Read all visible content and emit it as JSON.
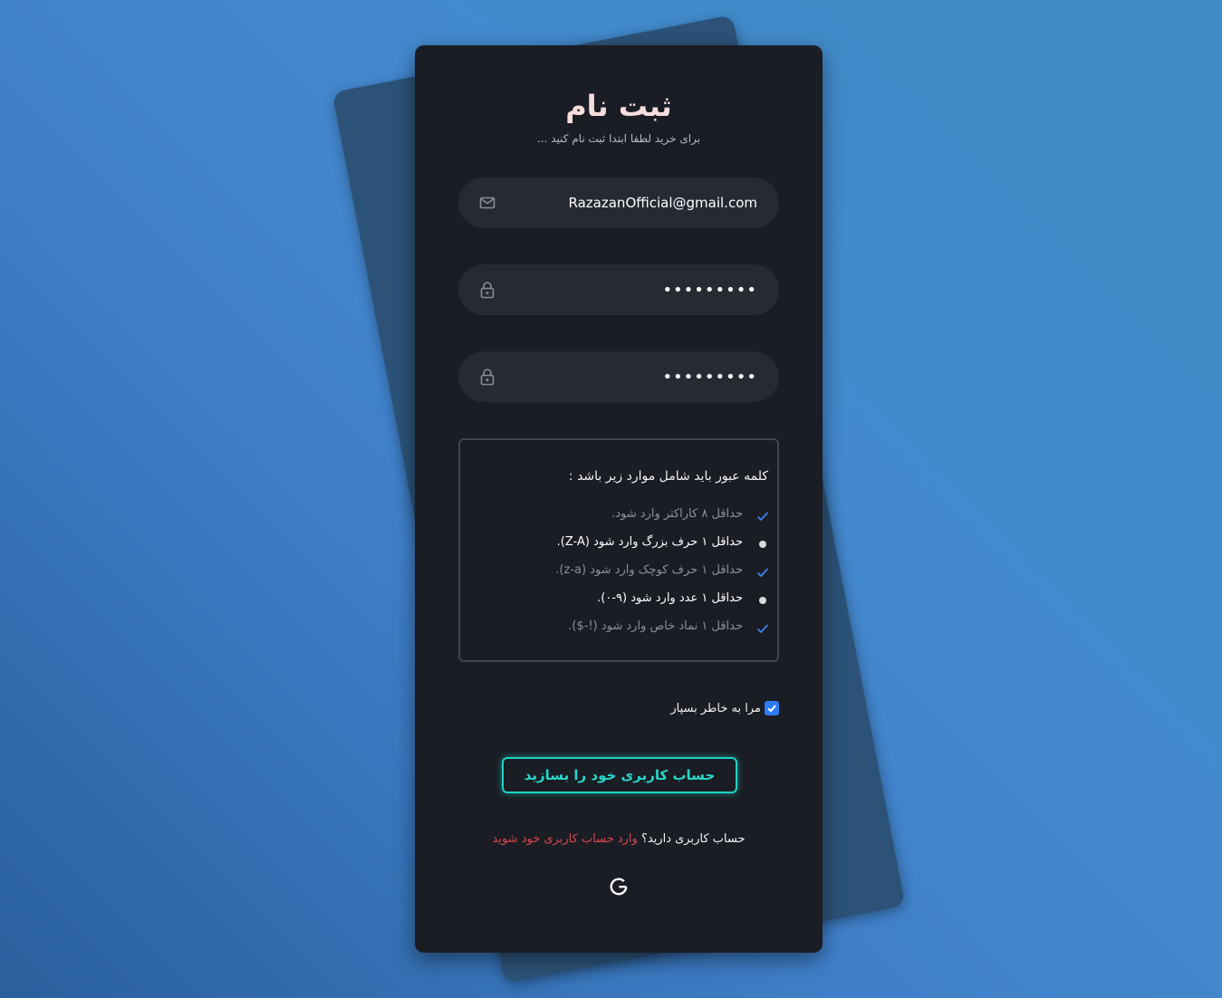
{
  "form": {
    "title": "ثبت نام",
    "subtitle": "برای خرید لطفا ابتدا ثبت نام کنید ...",
    "email": {
      "value": "RazazanOfficial@gmail.com",
      "icon": "mail-icon"
    },
    "password": {
      "value": "•••••••••",
      "icon": "lock-icon"
    },
    "confirm_password": {
      "value": "•••••••••",
      "icon": "lock-icon"
    }
  },
  "rules": {
    "title": "کلمه عبور باید شامل موارد زیر باشد :",
    "items": [
      {
        "text": "حداقل ۸ کاراکتر وارد شود.",
        "status": "ok"
      },
      {
        "text": "حداقل ۱ حرف بزرگ وارد شود (Z-A).",
        "status": "pending"
      },
      {
        "text": "حداقل ۱ حرف کوچک وارد شود (z-a).",
        "status": "ok"
      },
      {
        "text": "حداقل ۱ عدد وارد شود (۹-۰).",
        "status": "pending"
      },
      {
        "text": "حداقل ۱ نماد خاص وارد شود (!-$).",
        "status": "ok"
      }
    ]
  },
  "remember": {
    "label": "مرا به خاطر بسپار",
    "checked": true
  },
  "submit_label": "حساب کاربری خود را بسازید",
  "login": {
    "prompt": "حساب کاربری دارید؟",
    "link": "وارد حساب کاربری خود شوید"
  },
  "social": {
    "google_icon": "google-icon"
  },
  "colors": {
    "background": "#3f7fc9",
    "card": "#1b1d24",
    "accent": "#1fd3c6",
    "link": "#d9464c",
    "check": "#2f7bf5"
  }
}
